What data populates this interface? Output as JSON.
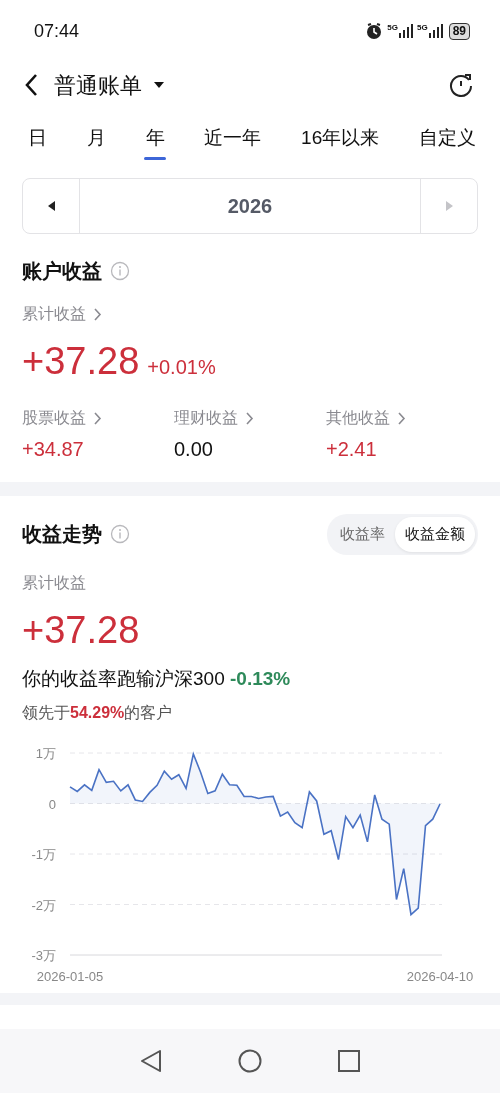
{
  "status_bar": {
    "time": "07:44",
    "networks": [
      "5G",
      "5G"
    ],
    "battery": "89"
  },
  "header": {
    "title": "普通账单"
  },
  "tabs": [
    {
      "label": "日",
      "selected": false
    },
    {
      "label": "月",
      "selected": false
    },
    {
      "label": "年",
      "selected": true
    },
    {
      "label": "近一年",
      "selected": false
    },
    {
      "label": "16年以来",
      "selected": false
    },
    {
      "label": "自定义",
      "selected": false
    }
  ],
  "year_picker": {
    "value": "2026",
    "prev_disabled": false,
    "next_disabled": true
  },
  "account_earnings": {
    "title": "账户收益",
    "total_label": "累计收益",
    "total": "+37.28",
    "total_rate": "+0.01%",
    "breakdown": [
      {
        "label": "股票收益",
        "value": "+34.87",
        "color": "#cc2f3b"
      },
      {
        "label": "理财收益",
        "value": "0.00",
        "color": "#111111"
      },
      {
        "label": "其他收益",
        "value": "+2.41",
        "color": "#cc2f3b"
      }
    ]
  },
  "earnings_trend": {
    "title": "收益走势",
    "toggle": [
      {
        "label": "收益率",
        "selected": false
      },
      {
        "label": "收益金额",
        "selected": true
      }
    ],
    "total_label": "累计收益",
    "total": "+37.28",
    "comparison": "你的收益率跑输沪深300 **-0.13%**",
    "rank": "领先于**54.29%**的客户",
    "chart_data": {
      "type": "area",
      "categories": [
        "2026-01-05",
        null,
        null,
        null,
        null,
        null,
        null,
        null,
        null,
        null,
        null,
        null,
        null,
        null,
        null,
        null,
        null,
        null,
        null,
        null,
        null,
        null,
        null,
        null,
        null,
        null,
        null,
        null,
        null,
        null,
        null,
        null,
        null,
        null,
        null,
        null,
        null,
        null,
        null,
        null,
        null,
        null,
        null,
        null,
        null,
        null,
        null,
        null,
        null,
        null,
        null,
        "2026-04-10"
      ],
      "series": [
        {
          "color": "#4a72c4",
          "values": [
            0.33,
            0.24,
            0.37,
            0.26,
            0.67,
            0.42,
            0.44,
            0.25,
            0.37,
            0.07,
            0.04,
            0.22,
            0.36,
            0.64,
            0.48,
            0.57,
            0.3,
            0.98,
            0.62,
            0.2,
            0.25,
            0.58,
            0.37,
            0.36,
            0.14,
            0.14,
            0.1,
            0.13,
            0.14,
            -0.25,
            -0.17,
            -0.38,
            -0.48,
            0.23,
            0.05,
            -0.61,
            -0.54,
            -1.11,
            -0.26,
            -0.48,
            -0.23,
            -0.76,
            0.17,
            -0.31,
            -0.41,
            -1.9,
            -1.29,
            -2.2,
            -2.07,
            -0.44,
            -0.31,
            -0.01
          ]
        }
      ],
      "ylim": [
        -3,
        1
      ],
      "grid": true,
      "yticks": [
        {
          "value": 1,
          "label": "1万"
        },
        {
          "value": 0,
          "label": "0"
        },
        {
          "value": -1,
          "label": "-1万"
        },
        {
          "value": -2,
          "label": "-2万"
        },
        {
          "value": -3,
          "label": "-3万"
        }
      ]
    }
  }
}
